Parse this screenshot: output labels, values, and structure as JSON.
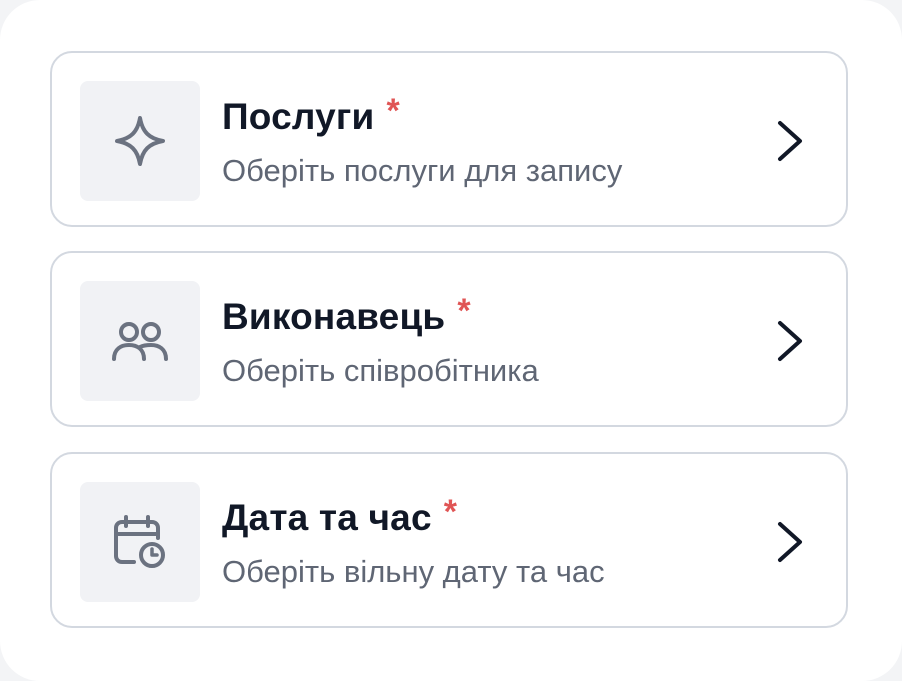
{
  "steps": [
    {
      "title": "Послуги",
      "required_mark": "*",
      "subtitle": "Оберіть послуги для запису",
      "icon": "sparkle-icon"
    },
    {
      "title": "Виконавець",
      "required_mark": "*",
      "subtitle": "Оберіть співробітника",
      "icon": "users-icon"
    },
    {
      "title": "Дата та час",
      "required_mark": "*",
      "subtitle": "Оберіть вільну дату та час",
      "icon": "calendar-clock-icon"
    }
  ],
  "colors": {
    "required": "#e05555",
    "title": "#111827",
    "subtitle": "#5f6674",
    "icon": "#6b7280",
    "icon_bg": "#f1f2f5",
    "border": "#d3d8e0"
  }
}
